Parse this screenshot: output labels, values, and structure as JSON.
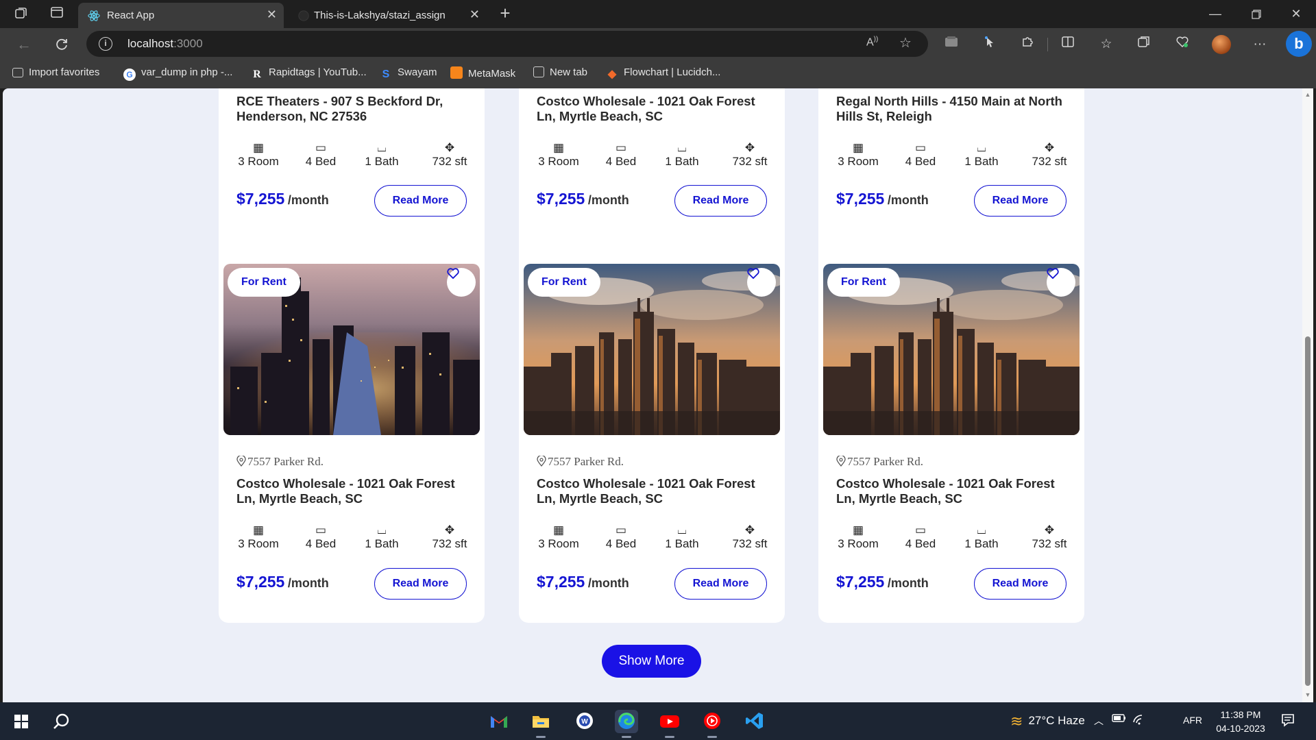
{
  "browser": {
    "tabs": [
      {
        "title": "React App",
        "active": true
      },
      {
        "title": "This-is-Lakshya/stazi_assign",
        "active": false
      }
    ],
    "url": {
      "host": "localhost",
      "port": ":3000"
    },
    "bookmarks": [
      {
        "label": "Import favorites",
        "icon": "import-icon"
      },
      {
        "label": "var_dump in php -...",
        "icon": "google-icon"
      },
      {
        "label": "Rapidtags | YouTub...",
        "icon": "rapidtags-icon"
      },
      {
        "label": "Swayam",
        "icon": "swayam-icon"
      },
      {
        "label": "MetaMask",
        "icon": "metamask-icon"
      },
      {
        "label": "New tab",
        "icon": "newtab-icon"
      },
      {
        "label": "Flowchart | Lucidch...",
        "icon": "lucid-icon"
      }
    ]
  },
  "page": {
    "top_cards": [
      {
        "title": "RCE Theaters - 907 S Beckford Dr, Henderson, NC 27536",
        "room": "3 Room",
        "bed": "4 Bed",
        "bath": "1 Bath",
        "area": "732 sft",
        "price": "$7,255",
        "per": "/month",
        "read_more": "Read More"
      },
      {
        "title": "Costco Wholesale - 1021 Oak Forest Ln, Myrtle Beach, SC",
        "room": "3 Room",
        "bed": "4 Bed",
        "bath": "1 Bath",
        "area": "732 sft",
        "price": "$7,255",
        "per": "/month",
        "read_more": "Read More"
      },
      {
        "title": "Regal North Hills - 4150 Main at North Hills St, Releigh",
        "room": "3 Room",
        "bed": "4 Bed",
        "bath": "1 Bath",
        "area": "732 sft",
        "price": "$7,255",
        "per": "/month",
        "read_more": "Read More"
      }
    ],
    "bottom_cards": [
      {
        "badge": "For Rent",
        "image": "city-night",
        "address": "7557 Parker Rd.",
        "title": "Costco Wholesale - 1021 Oak Forest Ln, Myrtle Beach, SC",
        "room": "3 Room",
        "bed": "4 Bed",
        "bath": "1 Bath",
        "area": "732 sft",
        "price": "$7,255",
        "per": "/month",
        "read_more": "Read More"
      },
      {
        "badge": "For Rent",
        "image": "city-sunset",
        "address": "7557 Parker Rd.",
        "title": "Costco Wholesale - 1021 Oak Forest Ln, Myrtle Beach, SC",
        "room": "3 Room",
        "bed": "4 Bed",
        "bath": "1 Bath",
        "area": "732 sft",
        "price": "$7,255",
        "per": "/month",
        "read_more": "Read More"
      },
      {
        "badge": "For Rent",
        "image": "city-sunset",
        "address": "7557 Parker Rd.",
        "title": "Costco Wholesale - 1021 Oak Forest Ln, Myrtle Beach, SC",
        "room": "3 Room",
        "bed": "4 Bed",
        "bath": "1 Bath",
        "area": "732 sft",
        "price": "$7,255",
        "per": "/month",
        "read_more": "Read More"
      }
    ],
    "show_more": "Show More",
    "colors": {
      "accent": "#1414d2",
      "button": "#1a12e6",
      "background": "#eceff8"
    }
  },
  "taskbar": {
    "apps": [
      "gmail-icon",
      "file-explorer-icon",
      "wps-icon",
      "edge-icon",
      "youtube-icon",
      "youtube-music-icon",
      "vscode-icon"
    ],
    "weather": "27°C  Haze",
    "lang": "AFR",
    "time": "11:38 PM",
    "date": "04-10-2023"
  }
}
